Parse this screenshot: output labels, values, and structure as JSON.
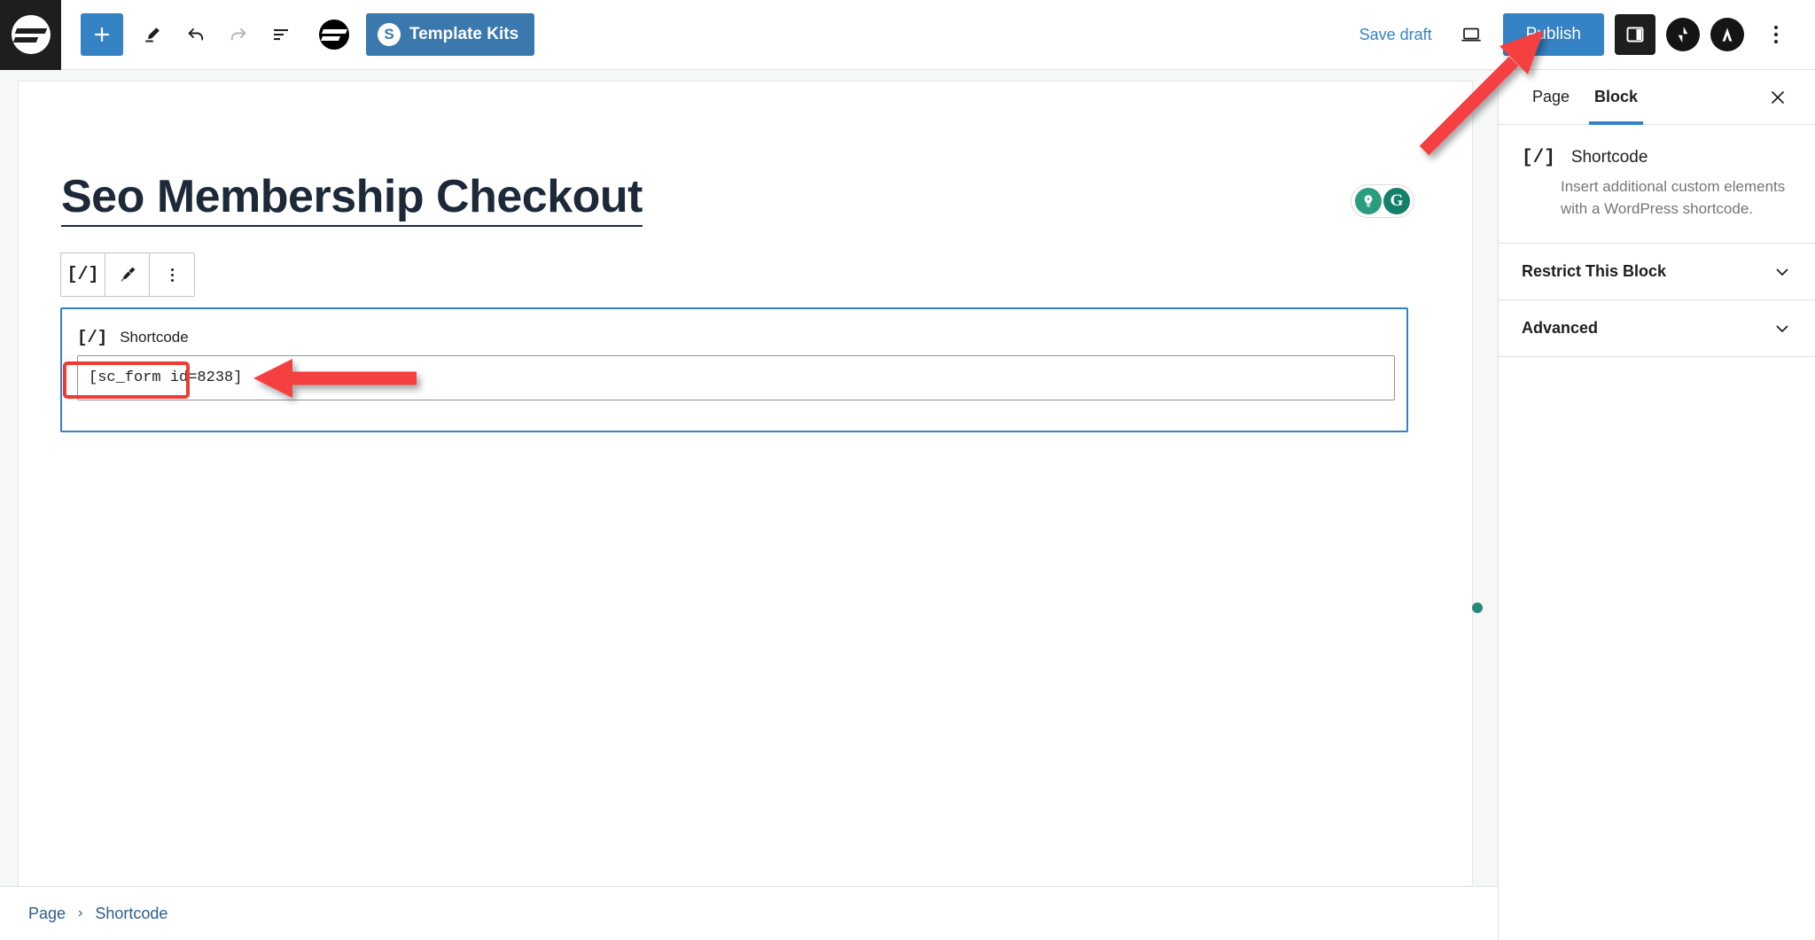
{
  "toolbar": {
    "logo_icon": "wordpress-site-logo-icon",
    "add_block_label": "+",
    "tools_icon": "pencil-tool-icon",
    "undo_icon": "undo-icon",
    "redo_icon": "redo-icon",
    "list_view_icon": "document-overview-icon",
    "envato_icon": "envato-logo-icon",
    "template_kits_label": "Template Kits",
    "template_kits_badge": "S",
    "save_draft_label": "Save draft",
    "preview_icon": "laptop-preview-icon",
    "publish_label": "Publish",
    "settings_sidebar_icon": "settings-panel-icon",
    "jetpack_icon": "jetpack-icon",
    "astra_icon": "astra-icon",
    "options_icon": "kebab-menu-icon",
    "accent_blue": "#3582c4",
    "template_kits_blue": "#3a78ad"
  },
  "editor": {
    "page_title": "Seo Membership Checkout",
    "grammarly": {
      "bulb_icon": "grammarly-assistant-icon",
      "g_icon": "grammarly-logo-icon",
      "bulb_color": "#2a9d7f",
      "g_color": "#15806a"
    },
    "block_toolbar": {
      "shortcode_icon": "[/]",
      "edit_icon": "paintbrush-icon",
      "more_icon": "block-options-icon"
    },
    "shortcode_block": {
      "icon": "[/]",
      "label": "Shortcode",
      "value": "[sc_form id=8238]",
      "selection_color": "#3582c4"
    },
    "status_dot_color": "#288a74"
  },
  "sidebar": {
    "tabs": [
      {
        "label": "Page",
        "active": false
      },
      {
        "label": "Block",
        "active": true
      }
    ],
    "close_icon": "close-icon",
    "block_info": {
      "icon": "[/]",
      "title": "Shortcode",
      "description": "Insert additional custom elements with a WordPress shortcode."
    },
    "panels": [
      {
        "label": "Restrict This Block",
        "chevron": "chevron-down-icon"
      },
      {
        "label": "Advanced",
        "chevron": "chevron-down-icon"
      }
    ]
  },
  "breadcrumb": {
    "items": [
      "Page",
      "Shortcode"
    ],
    "separator": "›"
  },
  "annotations": {
    "arrow_color": "#f43f3f",
    "publish_arrow": "arrow-pointing-to-publish-button",
    "shortcode_arrow": "arrow-pointing-to-shortcode-input",
    "highlight_box": "red-highlight-box-around-shortcode-value"
  }
}
